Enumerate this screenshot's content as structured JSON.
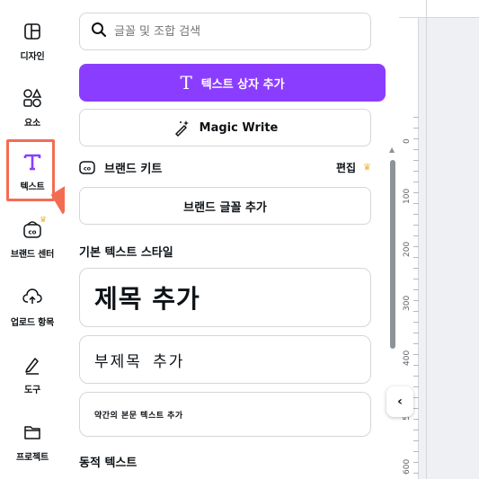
{
  "rail": {
    "items": [
      {
        "label": "디자인",
        "icon": "layout-icon"
      },
      {
        "label": "요소",
        "icon": "shapes-icon"
      },
      {
        "label": "텍스트",
        "icon": "text-T-icon"
      },
      {
        "label": "브랜드 센터",
        "icon": "brand-hub-icon"
      },
      {
        "label": "업로드 항목",
        "icon": "cloud-upload-icon"
      },
      {
        "label": "도구",
        "icon": "pen-tool-icon"
      },
      {
        "label": "프로젝트",
        "icon": "folder-icon"
      }
    ]
  },
  "panel": {
    "search_placeholder": "글꼴 및 조합 검색",
    "add_textbox_label": "텍스트 상자 추가",
    "magic_write_label": "Magic Write",
    "brand_kit_title": "브랜드 키트",
    "brand_edit_label": "편집",
    "add_brand_font_label": "브랜드 글꼴 추가",
    "default_styles_title": "기본 텍스트 스타일",
    "heading_label": "제목 추가",
    "subheading_label": "부제목 추가",
    "body_label": "약간의 본문 텍스트 추가",
    "dynamic_text_title": "동적 텍스트"
  },
  "ruler": {
    "marks": [
      "0",
      "100",
      "200",
      "300",
      "400",
      "500",
      "600"
    ]
  },
  "colors": {
    "accent": "#8b3dff",
    "highlight": "#f36c52",
    "crown": "#f2b233"
  }
}
